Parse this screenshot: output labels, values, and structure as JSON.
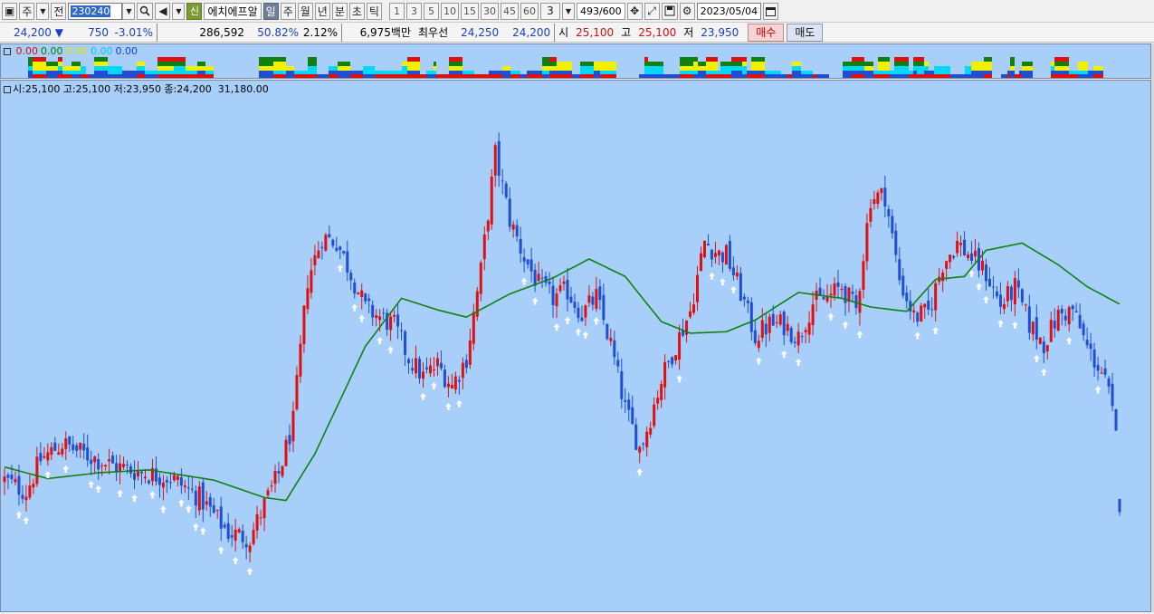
{
  "toolbar": {
    "left_icon": "window-icon",
    "type_label": "주",
    "mode_label": "전",
    "code": "230240",
    "shin_badge": "신",
    "stock_name": "에치에프알",
    "periods": [
      "일",
      "주",
      "월",
      "년",
      "분",
      "초",
      "틱"
    ],
    "selected_period": "일",
    "intervals": [
      "1",
      "3",
      "5",
      "10",
      "15",
      "30",
      "45",
      "60"
    ],
    "interval_value": "3",
    "counter_current": "493",
    "counter_total": "/600",
    "date": "2023/05/04"
  },
  "quote": {
    "price": "24,200",
    "change_arrow": "▼",
    "change": "750",
    "change_pct": "-3.01%",
    "volume": "286,592",
    "volume_ratio": "50.82%",
    "turnover": "2.12%",
    "amount": "6,975백만",
    "best_label": "최우선",
    "best_ask": "24,250",
    "best_bid": "24,200",
    "open_label": "시",
    "open": "25,100",
    "high_label": "고",
    "high": "25,100",
    "low_label": "저",
    "low": "23,950",
    "buy_label": "매수",
    "sell_label": "매도"
  },
  "indicator_pane": {
    "legend": [
      {
        "text": "0.00",
        "color": "#d01010"
      },
      {
        "text": "0.00",
        "color": "#008000"
      },
      {
        "text": "0.00",
        "color": "#e0e000"
      },
      {
        "text": "0.00",
        "color": "#00c8ff"
      },
      {
        "text": "0.00",
        "color": "#1a3fbf"
      }
    ]
  },
  "price_pane": {
    "legend": "시:25,100 고:25,100 저:23,950 종:24,200",
    "legend_extra": "31,180.00"
  },
  "colors": {
    "background": "#a8cff9",
    "up": "#e01010",
    "down": "#1f4fd0",
    "ma": "#108010",
    "signal": "#ffffff"
  },
  "chart_data": {
    "type": "candlestick",
    "title": "",
    "xlabel": "",
    "ylabel": "",
    "ylim": [
      18000,
      52000
    ],
    "candle_count": 200,
    "last_close": 24200,
    "last_open": 25100,
    "last_high": 25100,
    "last_low": 23950,
    "close_keypoints": [
      [
        0,
        26400
      ],
      [
        6,
        25600
      ],
      [
        10,
        27800
      ],
      [
        16,
        28900
      ],
      [
        22,
        28200
      ],
      [
        30,
        27400
      ],
      [
        38,
        26900
      ],
      [
        46,
        26600
      ],
      [
        54,
        25200
      ],
      [
        62,
        22800
      ],
      [
        68,
        22400
      ],
      [
        72,
        24700
      ],
      [
        76,
        26800
      ],
      [
        80,
        30400
      ],
      [
        84,
        40200
      ],
      [
        88,
        43100
      ],
      [
        92,
        42800
      ],
      [
        96,
        40600
      ],
      [
        100,
        38200
      ],
      [
        104,
        37600
      ],
      [
        108,
        37000
      ],
      [
        112,
        34800
      ],
      [
        116,
        33500
      ],
      [
        120,
        34300
      ],
      [
        124,
        32900
      ],
      [
        128,
        34800
      ],
      [
        132,
        40800
      ],
      [
        136,
        48800
      ],
      [
        140,
        44300
      ],
      [
        144,
        41700
      ],
      [
        148,
        39800
      ],
      [
        152,
        38900
      ],
      [
        156,
        39400
      ],
      [
        160,
        37800
      ],
      [
        164,
        39000
      ],
      [
        168,
        35700
      ],
      [
        172,
        31300
      ],
      [
        176,
        28600
      ],
      [
        178,
        29900
      ],
      [
        182,
        33300
      ],
      [
        186,
        35700
      ],
      [
        190,
        38000
      ],
      [
        194,
        42800
      ],
      [
        198,
        41900
      ],
      [
        200,
        41900
      ],
      [
        204,
        39300
      ],
      [
        208,
        36300
      ],
      [
        212,
        37100
      ],
      [
        216,
        37100
      ],
      [
        220,
        36200
      ],
      [
        224,
        38600
      ],
      [
        228,
        38900
      ],
      [
        232,
        39700
      ],
      [
        236,
        38100
      ],
      [
        240,
        45800
      ],
      [
        244,
        46000
      ],
      [
        248,
        40200
      ],
      [
        252,
        37600
      ],
      [
        256,
        37900
      ],
      [
        260,
        41300
      ],
      [
        264,
        42700
      ],
      [
        268,
        41700
      ],
      [
        272,
        40600
      ],
      [
        276,
        38400
      ],
      [
        280,
        39600
      ],
      [
        284,
        37100
      ],
      [
        288,
        35800
      ],
      [
        292,
        37700
      ],
      [
        296,
        38100
      ],
      [
        300,
        35500
      ],
      [
        304,
        33800
      ],
      [
        306,
        32300
      ],
      [
        309,
        27900
      ]
    ],
    "moving_average": [
      [
        0,
        27300
      ],
      [
        12,
        26500
      ],
      [
        26,
        26900
      ],
      [
        40,
        27100
      ],
      [
        58,
        26400
      ],
      [
        72,
        25200
      ],
      [
        78,
        25000
      ],
      [
        86,
        28200
      ],
      [
        100,
        35600
      ],
      [
        110,
        38900
      ],
      [
        120,
        38100
      ],
      [
        128,
        37600
      ],
      [
        140,
        39200
      ],
      [
        152,
        40300
      ],
      [
        162,
        41600
      ],
      [
        172,
        40400
      ],
      [
        182,
        37300
      ],
      [
        190,
        36500
      ],
      [
        200,
        36600
      ],
      [
        208,
        37400
      ],
      [
        220,
        39300
      ],
      [
        232,
        38900
      ],
      [
        240,
        38300
      ],
      [
        250,
        38000
      ],
      [
        258,
        40200
      ],
      [
        266,
        40400
      ],
      [
        272,
        42200
      ],
      [
        282,
        42700
      ],
      [
        292,
        41200
      ],
      [
        300,
        39700
      ],
      [
        309,
        38500
      ]
    ],
    "signal_arrows_count": 62
  }
}
